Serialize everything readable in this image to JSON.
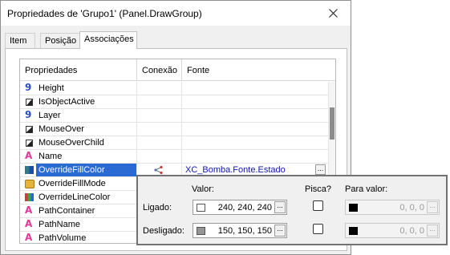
{
  "window": {
    "title": "Propriedades de 'Grupo1' (Panel.DrawGroup)"
  },
  "tabs": [
    {
      "label": "Item",
      "active": false
    },
    {
      "label": "Posição",
      "active": false
    },
    {
      "label": "Associações",
      "active": true
    }
  ],
  "grid": {
    "headers": {
      "properties": "Propriedades",
      "connection": "Conexão",
      "source": "Fonte"
    },
    "rows": [
      {
        "name": "Height",
        "type_icon": "number-type-icon"
      },
      {
        "name": "IsObjectActive",
        "type_icon": "boolean-type-icon"
      },
      {
        "name": "Layer",
        "type_icon": "number-type-icon"
      },
      {
        "name": "MouseOver",
        "type_icon": "boolean-type-icon"
      },
      {
        "name": "MouseOverChild",
        "type_icon": "boolean-type-icon"
      },
      {
        "name": "Name",
        "type_icon": "string-type-icon"
      },
      {
        "name": "OverrideFillColor",
        "type_icon": "color-type-icon",
        "selected": true,
        "connection_icon": "link-icon",
        "source": "XC_Bomba.Fonte.Estado"
      },
      {
        "name": "OverrideFillMode",
        "type_icon": "mode-type-icon"
      },
      {
        "name": "OverrideLineColor",
        "type_icon": "color-type-icon"
      },
      {
        "name": "PathContainer",
        "type_icon": "string-type-icon"
      },
      {
        "name": "PathName",
        "type_icon": "string-type-icon"
      },
      {
        "name": "PathVolume",
        "type_icon": "string-type-icon"
      }
    ],
    "ellipsis": "..."
  },
  "popup": {
    "header_valor": "Valor:",
    "header_pisca": "Pisca?",
    "header_para_valor": "Para valor:",
    "rows": [
      {
        "label": "Ligado:",
        "color": "#ffffff",
        "value": "240, 240, 240",
        "blink": false,
        "para_color": "#000000",
        "para_value": "0, 0, 0"
      },
      {
        "label": "Desligado:",
        "color": "#969696",
        "value": "150, 150, 150",
        "blink": false,
        "para_color": "#000000",
        "para_value": "0, 0, 0"
      }
    ]
  }
}
